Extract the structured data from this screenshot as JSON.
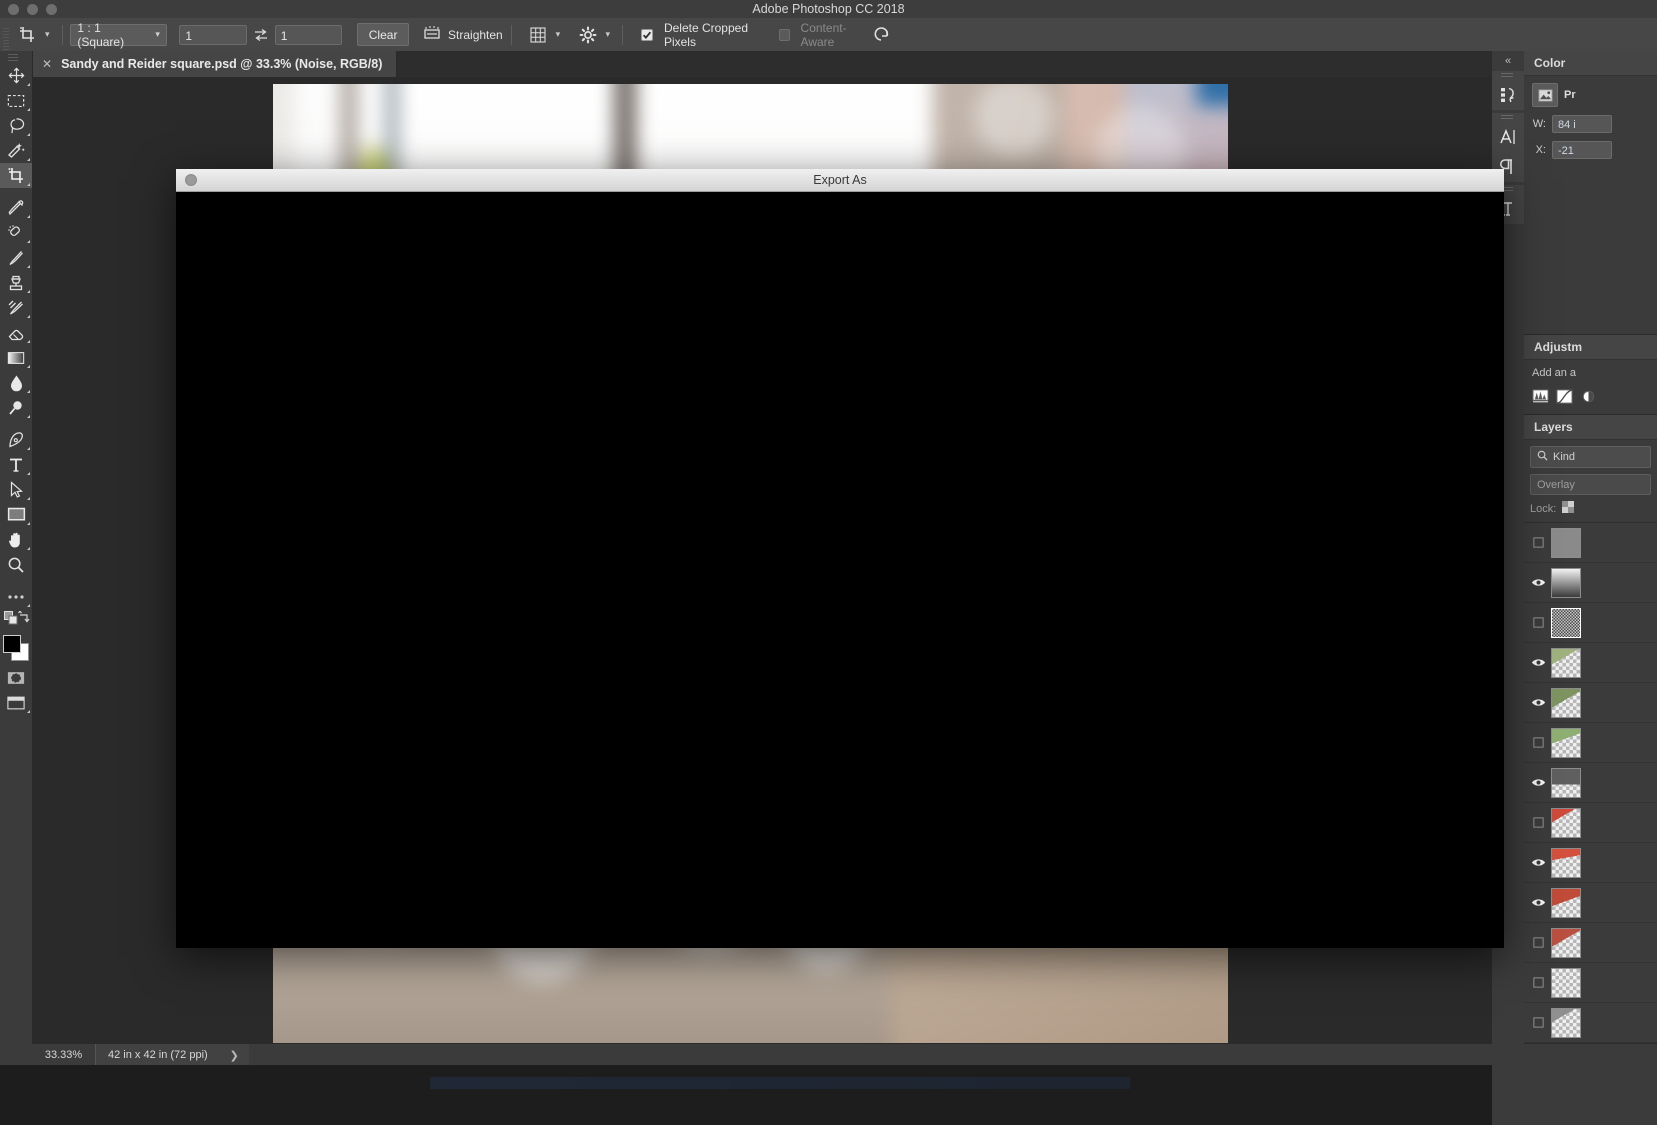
{
  "window": {
    "app_title": "Adobe Photoshop CC 2018"
  },
  "options_bar": {
    "tool_icon": "crop-tool-icon",
    "aspect_preset": "1 : 1 (Square)",
    "width_value": "1",
    "height_value": "1",
    "swap_icon": "swap-arrows-icon",
    "clear_label": "Clear",
    "straighten_icon": "straighten-icon",
    "straighten_label": "Straighten",
    "overlay_icon": "grid-overlay-icon",
    "settings_icon": "gear-icon",
    "delete_cropped_label": "Delete Cropped Pixels",
    "delete_cropped_checked": true,
    "content_aware_label": "Content-Aware",
    "content_aware_checked": false,
    "reset_icon": "reset-arrow-icon"
  },
  "document_tab": {
    "close_icon": "close-icon",
    "title": "Sandy and Reider square.psd @ 33.3% (Noise, RGB/8)"
  },
  "toolbar": {
    "tools": [
      {
        "name": "move-tool",
        "icon": "move-arrows-icon",
        "selected": false,
        "has_flyout": true
      },
      {
        "name": "rectangular-marquee-tool",
        "icon": "marquee-dashed-rect-icon",
        "selected": false,
        "has_flyout": true
      },
      {
        "name": "lasso-tool",
        "icon": "lasso-icon",
        "selected": false,
        "has_flyout": true
      },
      {
        "name": "quick-selection-tool",
        "icon": "magic-wand-icon",
        "selected": false,
        "has_flyout": true
      },
      {
        "name": "crop-tool",
        "icon": "crop-tool-icon",
        "selected": true,
        "has_flyout": true
      },
      {
        "name": "eyedropper-tool",
        "icon": "eyedropper-icon",
        "selected": false,
        "has_flyout": true
      },
      {
        "name": "spot-healing-brush-tool",
        "icon": "healing-bandage-icon",
        "selected": false,
        "has_flyout": true
      },
      {
        "name": "brush-tool",
        "icon": "paintbrush-icon",
        "selected": false,
        "has_flyout": true
      },
      {
        "name": "clone-stamp-tool",
        "icon": "clone-stamp-icon",
        "selected": false,
        "has_flyout": true
      },
      {
        "name": "history-brush-tool",
        "icon": "history-brush-icon",
        "selected": false,
        "has_flyout": true
      },
      {
        "name": "eraser-tool",
        "icon": "eraser-icon",
        "selected": false,
        "has_flyout": true
      },
      {
        "name": "gradient-tool",
        "icon": "gradient-icon",
        "selected": false,
        "has_flyout": true
      },
      {
        "name": "blur-tool",
        "icon": "waterdrop-icon",
        "selected": false,
        "has_flyout": true
      },
      {
        "name": "dodge-tool",
        "icon": "dodge-lollipop-icon",
        "selected": false,
        "has_flyout": true
      },
      {
        "name": "pen-tool",
        "icon": "pen-nib-icon",
        "selected": false,
        "has_flyout": true
      },
      {
        "name": "type-tool",
        "icon": "type-t-icon",
        "selected": false,
        "has_flyout": true
      },
      {
        "name": "path-selection-tool",
        "icon": "path-arrow-icon",
        "selected": false,
        "has_flyout": true
      },
      {
        "name": "rectangle-tool",
        "icon": "rectangle-shape-icon",
        "selected": false,
        "has_flyout": true
      },
      {
        "name": "hand-tool",
        "icon": "hand-icon",
        "selected": false,
        "has_flyout": true
      },
      {
        "name": "zoom-tool",
        "icon": "magnifier-icon",
        "selected": false,
        "has_flyout": false
      },
      {
        "name": "edit-toolbar",
        "icon": "ellipsis-icon",
        "selected": false,
        "has_flyout": true
      }
    ],
    "default_colors_icon": "default-colors-icon",
    "swap_colors_icon": "swap-colors-icon",
    "foreground_color": "#000000",
    "background_color": "#ffffff",
    "quick_mask_icon": "quick-mask-icon",
    "screen_mode_icon": "screen-mode-icon"
  },
  "right_rail": {
    "collapse_icon": "collapse-panels-icon",
    "groups": [
      {
        "items": [
          {
            "name": "history-panel-icon",
            "glyph": "history"
          }
        ]
      },
      {
        "items": [
          {
            "name": "character-panel-icon",
            "glyph": "character"
          },
          {
            "name": "paragraph-panel-icon",
            "glyph": "paragraph"
          }
        ]
      },
      {
        "items": [
          {
            "name": "glyphs-panel-icon",
            "glyph": "glyphs"
          }
        ]
      }
    ]
  },
  "panels": {
    "color": {
      "title": "Color",
      "mode_icon": "picker-image-icon",
      "mode_label": "Pr",
      "fields": [
        {
          "label": "W:",
          "value": "84 i"
        },
        {
          "label": "X:",
          "value": "-21"
        }
      ]
    },
    "adjustments": {
      "title": "Adjustm",
      "subtitle": "Add an a",
      "icons": [
        "levels-icon",
        "curves-icon",
        "exposure-icon"
      ]
    },
    "layers": {
      "title": "Layers",
      "filter_icon": "search-icon",
      "filter_label": "Kind",
      "blend_mode": "Overlay",
      "lock_label": "Lock:",
      "rows": [
        {
          "name": "layer-row",
          "visible": false,
          "thumb": "mask-thumb",
          "selected": false
        },
        {
          "name": "layer-row",
          "visible": true,
          "thumb": "adjustment-thumb",
          "selected": false
        },
        {
          "name": "layer-row",
          "visible": false,
          "thumb": "noise-thumb",
          "selected": true
        },
        {
          "name": "layer-row",
          "visible": true,
          "thumb": "photo-thumb-1",
          "selected": false
        },
        {
          "name": "layer-row",
          "visible": true,
          "thumb": "photo-thumb-2",
          "selected": false
        },
        {
          "name": "layer-row",
          "visible": false,
          "thumb": "photo-thumb-3",
          "selected": false
        },
        {
          "name": "layer-row",
          "visible": true,
          "thumb": "photo-thumb-4",
          "selected": false
        },
        {
          "name": "layer-row",
          "visible": false,
          "thumb": "photo-thumb-5",
          "selected": false
        },
        {
          "name": "layer-row",
          "visible": true,
          "thumb": "photo-thumb-6",
          "selected": false
        },
        {
          "name": "layer-row",
          "visible": true,
          "thumb": "photo-thumb-7",
          "selected": false
        },
        {
          "name": "layer-row",
          "visible": false,
          "thumb": "photo-thumb-8",
          "selected": false
        },
        {
          "name": "layer-row",
          "visible": false,
          "thumb": "photo-thumb-9",
          "selected": false
        },
        {
          "name": "layer-row",
          "visible": false,
          "thumb": "photo-thumb-10",
          "selected": false
        }
      ]
    }
  },
  "status_bar": {
    "zoom": "33.33%",
    "doc_size": "42 in x 42 in (72 ppi)",
    "expand_icon": "chevron-right-icon"
  },
  "export_dialog": {
    "title": "Export As",
    "close_icon": "window-close-dot-icon"
  }
}
